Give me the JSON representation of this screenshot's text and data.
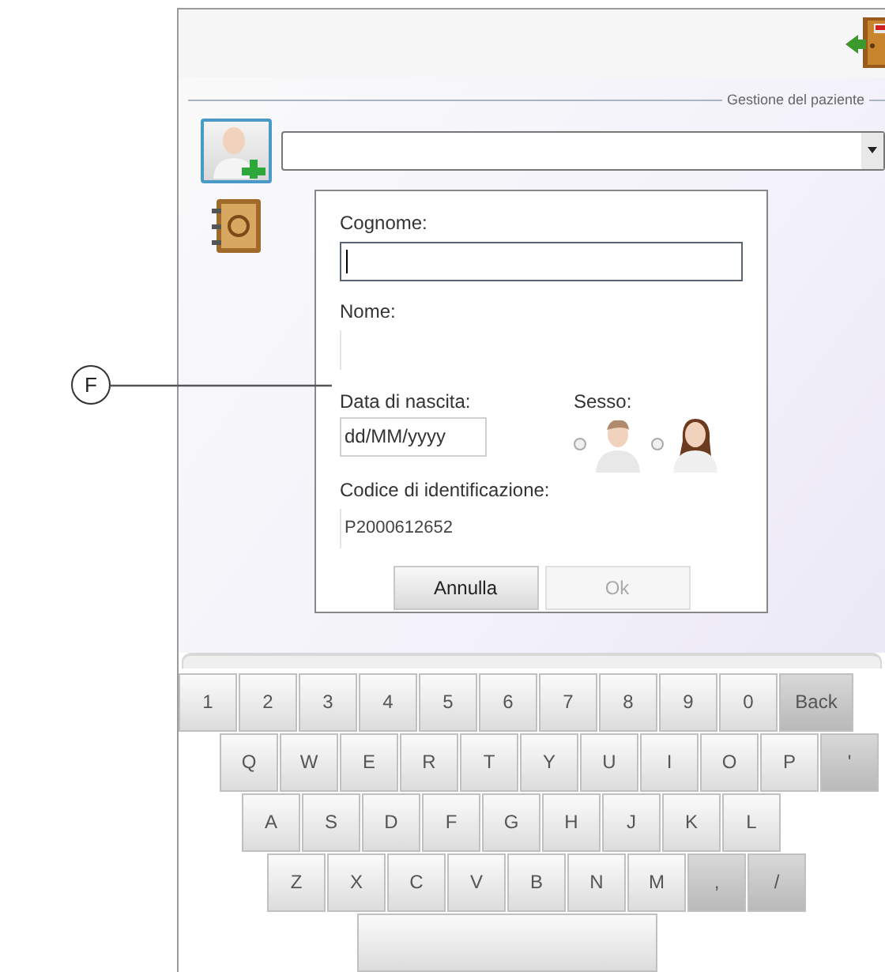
{
  "callout": {
    "label": "F"
  },
  "header": {
    "section_title": "Gestione del paziente"
  },
  "form": {
    "fields": [
      {
        "label": "Cognome:",
        "focused": true
      },
      {
        "label": "Nome:",
        "focused": false
      }
    ],
    "birth_date": {
      "label": "Data di nascita:",
      "value": "dd/MM/yyyy"
    },
    "gender": {
      "label": "Sesso:",
      "options": [
        {
          "kind": "male",
          "selected": false
        },
        {
          "kind": "female",
          "selected": false
        }
      ]
    },
    "id_code": {
      "label": "Codice di identificazione:",
      "value": "P2000612652"
    },
    "buttons": [
      {
        "label": "Annulla",
        "disabled": false
      },
      {
        "label": "Ok",
        "disabled": true
      }
    ]
  },
  "keyboard": {
    "rows": [
      [
        {
          "label": "1",
          "kind": "key"
        },
        {
          "label": "2",
          "kind": "key"
        },
        {
          "label": "3",
          "kind": "key"
        },
        {
          "label": "4",
          "kind": "key"
        },
        {
          "label": "5",
          "kind": "key"
        },
        {
          "label": "6",
          "kind": "key"
        },
        {
          "label": "7",
          "kind": "key"
        },
        {
          "label": "8",
          "kind": "key"
        },
        {
          "label": "9",
          "kind": "key"
        },
        {
          "label": "0",
          "kind": "key"
        },
        {
          "label": "Back",
          "kind": "wide"
        }
      ],
      [
        {
          "label": "Q",
          "kind": "key"
        },
        {
          "label": "W",
          "kind": "key"
        },
        {
          "label": "E",
          "kind": "key"
        },
        {
          "label": "R",
          "kind": "key"
        },
        {
          "label": "T",
          "kind": "key"
        },
        {
          "label": "Y",
          "kind": "key"
        },
        {
          "label": "U",
          "kind": "key"
        },
        {
          "label": "I",
          "kind": "key"
        },
        {
          "label": "O",
          "kind": "key"
        },
        {
          "label": "P",
          "kind": "key"
        },
        {
          "label": "'",
          "kind": "special"
        }
      ],
      [
        {
          "label": "A",
          "kind": "key"
        },
        {
          "label": "S",
          "kind": "key"
        },
        {
          "label": "D",
          "kind": "key"
        },
        {
          "label": "F",
          "kind": "key"
        },
        {
          "label": "G",
          "kind": "key"
        },
        {
          "label": "H",
          "kind": "key"
        },
        {
          "label": "J",
          "kind": "key"
        },
        {
          "label": "K",
          "kind": "key"
        },
        {
          "label": "L",
          "kind": "key"
        }
      ],
      [
        {
          "label": "Z",
          "kind": "key"
        },
        {
          "label": "X",
          "kind": "key"
        },
        {
          "label": "C",
          "kind": "key"
        },
        {
          "label": "V",
          "kind": "key"
        },
        {
          "label": "B",
          "kind": "key"
        },
        {
          "label": "N",
          "kind": "key"
        },
        {
          "label": "M",
          "kind": "key"
        },
        {
          "label": ",",
          "kind": "special"
        },
        {
          "label": "/",
          "kind": "special"
        }
      ],
      [
        {
          "kind": "space"
        }
      ]
    ]
  }
}
